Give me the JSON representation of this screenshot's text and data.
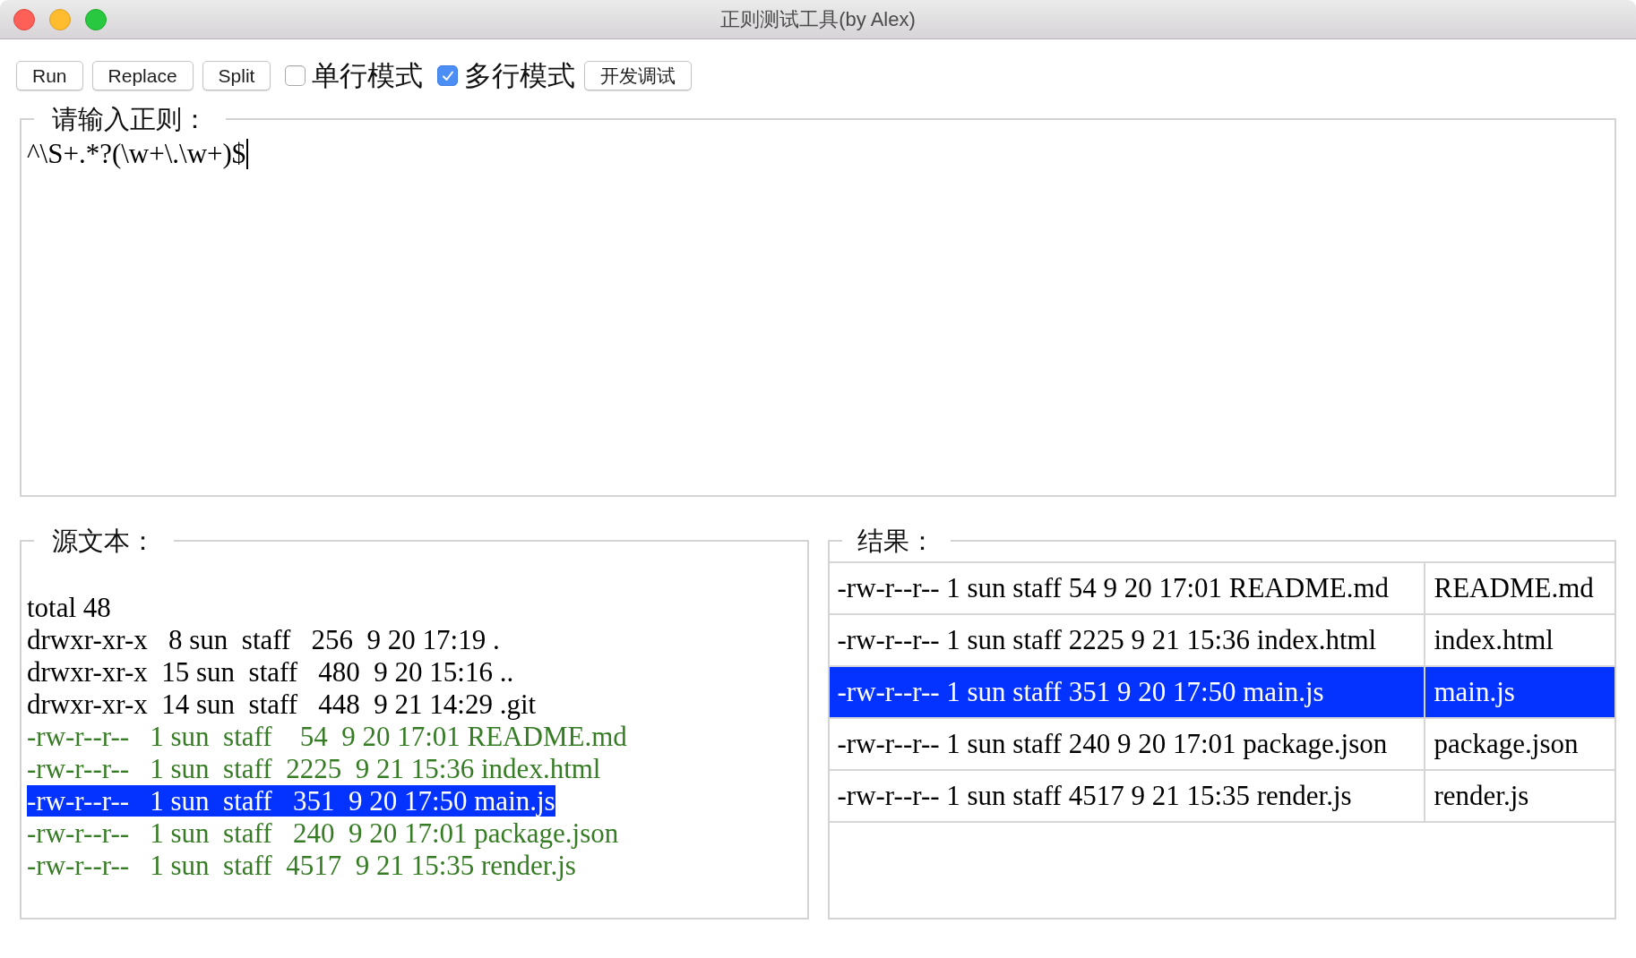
{
  "window": {
    "title": "正则测试工具(by Alex)"
  },
  "toolbar": [
    {
      "kind": "button",
      "label": "Run"
    },
    {
      "kind": "button",
      "label": "Replace"
    },
    {
      "kind": "button",
      "label": "Split"
    },
    {
      "kind": "checkbox",
      "label": "单行模式",
      "checked": false
    },
    {
      "kind": "checkbox",
      "label": "多行模式",
      "checked": true
    },
    {
      "kind": "button",
      "label": "开发调试"
    }
  ],
  "pattern": {
    "label": "请输入正则：",
    "value": "^\\S+.*?(\\w+\\.\\w+)$"
  },
  "source": {
    "label": "源文本：",
    "lines": [
      {
        "text": "total 48",
        "matched": false,
        "selected": false
      },
      {
        "text": "drwxr-xr-x   8 sun  staff   256  9 20 17:19 .",
        "matched": false,
        "selected": false
      },
      {
        "text": "drwxr-xr-x  15 sun  staff   480  9 20 15:16 ..",
        "matched": false,
        "selected": false
      },
      {
        "text": "drwxr-xr-x  14 sun  staff   448  9 21 14:29 .git",
        "matched": false,
        "selected": false
      },
      {
        "text": "-rw-r--r--   1 sun  staff    54  9 20 17:01 README.md",
        "matched": true,
        "selected": false
      },
      {
        "text": "-rw-r--r--   1 sun  staff  2225  9 21 15:36 index.html",
        "matched": true,
        "selected": false
      },
      {
        "text": "-rw-r--r--   1 sun  staff   351  9 20 17:50 main.js",
        "matched": true,
        "selected": true
      },
      {
        "text": "-rw-r--r--   1 sun  staff   240  9 20 17:01 package.json",
        "matched": true,
        "selected": false
      },
      {
        "text": "-rw-r--r--   1 sun  staff  4517  9 21 15:35 render.js",
        "matched": true,
        "selected": false
      }
    ]
  },
  "result": {
    "label": "结果：",
    "rows": [
      {
        "cells": [
          "-rw-r--r-- 1 sun staff 54 9 20 17:01 README.md",
          "README.md"
        ],
        "selected": false
      },
      {
        "cells": [
          "-rw-r--r-- 1 sun staff 2225 9 21 15:36 index.html",
          "index.html"
        ],
        "selected": false
      },
      {
        "cells": [
          "-rw-r--r-- 1 sun staff 351 9 20 17:50 main.js",
          "main.js"
        ],
        "selected": true
      },
      {
        "cells": [
          "-rw-r--r-- 1 sun staff 240 9 20 17:01 package.json",
          "package.json"
        ],
        "selected": false
      },
      {
        "cells": [
          "-rw-r--r-- 1 sun staff 4517 9 21 15:35 render.js",
          "render.js"
        ],
        "selected": false
      }
    ]
  }
}
